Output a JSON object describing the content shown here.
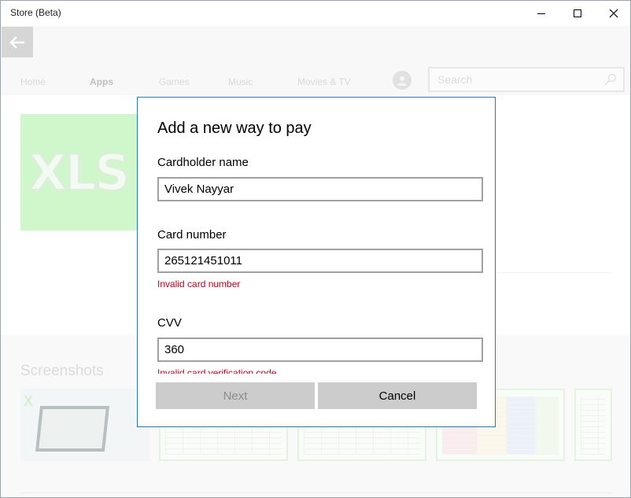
{
  "window": {
    "title": "Store (Beta)"
  },
  "nav": {
    "items": [
      "Home",
      "Apps",
      "Games",
      "Music",
      "Movies & TV"
    ],
    "active": "Apps"
  },
  "search": {
    "placeholder": "Search"
  },
  "app": {
    "logo_text": "XLS"
  },
  "screenshots": {
    "title": "Screenshots"
  },
  "dialog": {
    "title": "Add a new way to pay",
    "cardholder_label": "Cardholder name",
    "cardholder_value": "Vivek Nayyar",
    "card_number_label": "Card number",
    "card_number_value": "265121451011",
    "card_number_error": "Invalid card number",
    "cvv_label": "CVV",
    "cvv_value": "360",
    "cvv_error": "Invalid card verification code",
    "next_label": "Next",
    "cancel_label": "Cancel"
  },
  "colors": {
    "dialog_border": "#2a7ab0",
    "error": "#c4001f",
    "hero_bg": "#a9f0a0",
    "button_bg": "#cccccc"
  },
  "icons": {
    "back": "arrow-left-icon",
    "search": "magnifier-icon",
    "minimize": "minimize-icon",
    "maximize": "maximize-icon",
    "close": "close-icon",
    "avatar": "user-icon"
  }
}
